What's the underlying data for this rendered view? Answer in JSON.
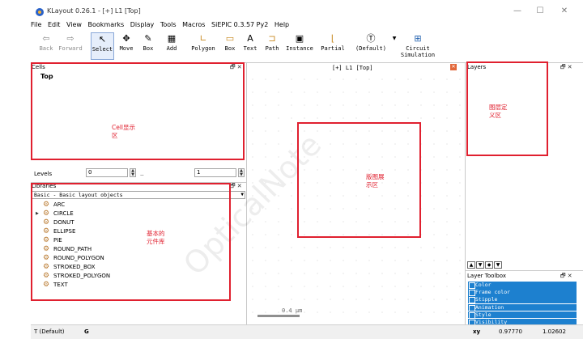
{
  "window": {
    "title": "KLayout 0.26.1 - [+] L1 [Top]",
    "controls": {
      "minimize": "—",
      "maximize": "☐",
      "close": "✕"
    }
  },
  "menu": [
    "File",
    "Edit",
    "View",
    "Bookmarks",
    "Display",
    "Tools",
    "Macros",
    "SiEPIC 0.3.57 Py2",
    "Help"
  ],
  "toolbar": {
    "back": "Back",
    "forward": "Forward",
    "select": "Select",
    "move": "Move",
    "box": "Box",
    "add": "Add",
    "polygon": "Polygon",
    "box2": "Box",
    "text": "Text",
    "path": "Path",
    "instance": "Instance",
    "partial": "Partial",
    "default": "(Default)",
    "circuit_sim_line1": "Circuit",
    "circuit_sim_line2": "Simulation"
  },
  "cells": {
    "title": "Cells",
    "top_cell": "Top",
    "levels_label": "Levels",
    "level_from": "0",
    "level_to": "1",
    "levels_dots": ".."
  },
  "libraries": {
    "title": "Libraries",
    "selected": "Basic - Basic layout objects",
    "items": [
      "ARC",
      "CIRCLE",
      "DONUT",
      "ELLIPSE",
      "PIE",
      "ROUND_PATH",
      "ROUND_POLYGON",
      "STROKED_BOX",
      "STROKED_POLYGON",
      "TEXT"
    ]
  },
  "canvas": {
    "tab_title": "[+] L1 [Top]",
    "scale_label": "0.4 µm"
  },
  "layers": {
    "title": "Layers"
  },
  "layer_toolbox": {
    "title": "Layer Toolbox",
    "rows": [
      "Color",
      "Frame color",
      "Stipple",
      "Animation",
      "Style",
      "Visibility"
    ]
  },
  "annotations": {
    "cells_display": [
      "Cell显示",
      "区"
    ],
    "layer_def": [
      "图层定",
      "义区"
    ],
    "layout_display": [
      "版图展",
      "示区"
    ],
    "basic_lib": [
      "基本的",
      "元件库"
    ]
  },
  "watermark": "OpticalNote",
  "status": {
    "mode": "T (Default)",
    "g_label": "G",
    "xy_label": "xy",
    "x_value": "0.97770",
    "y_value": "1.02602"
  },
  "colors": {
    "annotation": "#e0202f",
    "toolbox_row": "#1d80cf"
  }
}
